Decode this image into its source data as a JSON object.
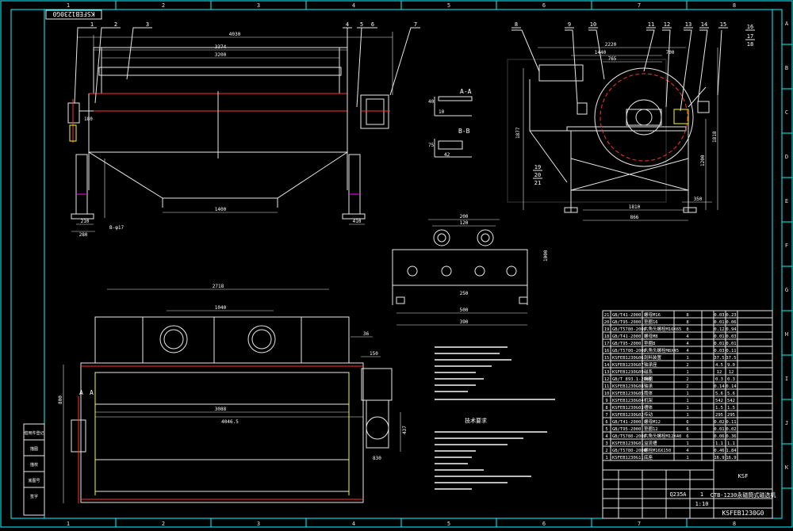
{
  "drawing_number_rotated": "KSFEB1230G0",
  "border_columns": [
    "1",
    "2",
    "3",
    "4",
    "5",
    "6",
    "7",
    "8"
  ],
  "border_rows": [
    "A",
    "B",
    "C",
    "D",
    "E",
    "F",
    "G",
    "H",
    "I",
    "J",
    "K"
  ],
  "balloons_top": [
    "1",
    "2",
    "3",
    "4",
    "5",
    "6",
    "7"
  ],
  "balloons_side": [
    "8",
    "9",
    "10",
    "11",
    "12",
    "13",
    "14",
    "15"
  ],
  "balloon_16_18": [
    "16",
    "17",
    "18"
  ],
  "balloon_19_21": [
    "19",
    "20",
    "21"
  ],
  "front_dims": {
    "overall": "4030",
    "mid": "3374",
    "inner": "3200",
    "bottom": "1400",
    "left_a": "210",
    "left_b": "280",
    "left_c": "B-φ17",
    "right": "410",
    "height": "180"
  },
  "side_dims": {
    "top": "2220",
    "top2": "1440",
    "top3": "700",
    "top4": "765",
    "h_main": "1877",
    "h_right": "1818",
    "h_mid": "1200",
    "bottom1": "1810",
    "bottom2": "866",
    "bottom3": "350"
  },
  "section_aa": "A-A",
  "section_bb": "B-B",
  "section_aa_dims": [
    "40",
    "10"
  ],
  "section_bb_dims": [
    "75",
    "42"
  ],
  "plan_dims": {
    "overall": "2718",
    "mid": "1040",
    "inner": "3088",
    "outer": "4046.5",
    "side": "800",
    "s1": "36",
    "s2": "150",
    "s3": "437",
    "s4": "830"
  },
  "flange_dims": [
    "120",
    "200",
    "250",
    "500",
    "390",
    "1000"
  ],
  "notes_title": "技术要求",
  "parts": [
    {
      "no": "21",
      "code": "GB/T41-2000",
      "name": "螺母M16",
      "qty": "8",
      "w1": "0.03",
      "w2": "0.23"
    },
    {
      "no": "20",
      "code": "GB/T95-2000",
      "name": "垫圈16",
      "qty": "8",
      "w1": "0.01",
      "w2": "0.06"
    },
    {
      "no": "19",
      "code": "GB/T5780-2000",
      "name": "六角头螺栓M16X65",
      "qty": "8",
      "w1": "0.12",
      "w2": "0.94"
    },
    {
      "no": "18",
      "code": "GB/T41-2000",
      "name": "螺母M8",
      "qty": "4",
      "w1": "0.01",
      "w2": "0.03"
    },
    {
      "no": "17",
      "code": "GB/T95-2000",
      "name": "垫圈8",
      "qty": "4",
      "w1": "0.01",
      "w2": "0.01"
    },
    {
      "no": "16",
      "code": "GB/T5780-2000",
      "name": "六角头螺栓M8X45",
      "qty": "4",
      "w1": "0.03",
      "w2": "0.11"
    },
    {
      "no": "15",
      "code": "KSFEB1230G06",
      "name": "刮料装置",
      "qty": "1",
      "w1": "37.5",
      "w2": "37.5"
    },
    {
      "no": "14",
      "code": "KSFEB1230G07",
      "name": "轴承座",
      "qty": "2",
      "w1": "4.5",
      "w2": "9.0"
    },
    {
      "no": "13",
      "code": "KSFEB1230G09",
      "name": "磁系",
      "qty": "1",
      "w1": "12",
      "w2": "12"
    },
    {
      "no": "12",
      "code": "GB/T 893.1-2000",
      "name": "挡圈",
      "qty": "2",
      "w1": "0.3",
      "w2": "0.3"
    },
    {
      "no": "11",
      "code": "KSFEB1230G08",
      "name": "轴承",
      "qty": "2",
      "w1": "0.14",
      "w2": "0.14"
    },
    {
      "no": "10",
      "code": "KSFEB1230G05",
      "name": "筒体",
      "qty": "1",
      "w1": "5.6",
      "w2": "5.6"
    },
    {
      "no": "9",
      "code": "KSFEB1230G04",
      "name": "机架",
      "qty": "1",
      "w1": "542",
      "w2": "542"
    },
    {
      "no": "8",
      "code": "KSFEB1230G03",
      "name": "槽体",
      "qty": "1",
      "w1": "1.5",
      "w2": "1.5"
    },
    {
      "no": "7",
      "code": "KSFEB1230G02",
      "name": "传动",
      "qty": "1",
      "w1": "295",
      "w2": "295"
    },
    {
      "no": "6",
      "code": "GB/T41-2000",
      "name": "螺母M12",
      "qty": "6",
      "w1": "0.02",
      "w2": "0.11"
    },
    {
      "no": "5",
      "code": "GB/T95-2000",
      "name": "垫圈12",
      "qty": "6",
      "w1": "0.01",
      "w2": "0.02"
    },
    {
      "no": "4",
      "code": "GB/T5780-2000",
      "name": "六角头螺栓M12X40",
      "qty": "6",
      "w1": "0.06",
      "w2": "0.36"
    },
    {
      "no": "3",
      "code": "KSFEB1230G01",
      "name": "溢流槽",
      "qty": "1",
      "w1": "1.1",
      "w2": "1.1"
    },
    {
      "no": "2",
      "code": "GB/T5780-2000",
      "name": "螺栓M16X150",
      "qty": "4",
      "w1": "0.46",
      "w2": "1.84"
    },
    {
      "no": "1",
      "code": "KSFEB1230G11",
      "name": "底座",
      "qty": "1",
      "w1": "16.9",
      "w2": "16.9"
    }
  ],
  "title_block": {
    "product": "CTB-1230永磁筒式磁选机",
    "drawing_no": "KSFEB1230G0",
    "scale": "1:10",
    "sheet": "1",
    "company": "KSF"
  },
  "left_stamp": [
    "借用件登记",
    "描图",
    "描校",
    "底图号",
    "签字"
  ],
  "right_material": "Q235A"
}
